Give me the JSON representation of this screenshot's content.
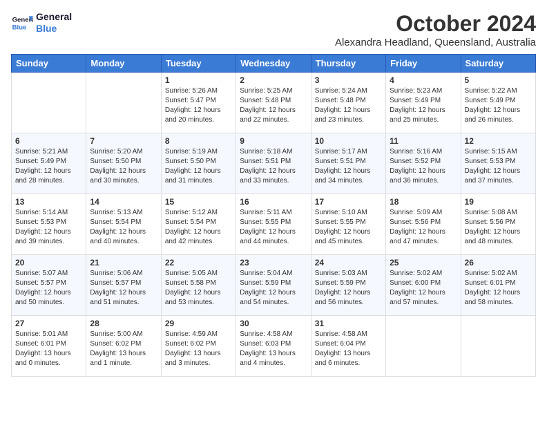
{
  "header": {
    "logo_line1": "General",
    "logo_line2": "Blue",
    "month": "October 2024",
    "location": "Alexandra Headland, Queensland, Australia"
  },
  "weekdays": [
    "Sunday",
    "Monday",
    "Tuesday",
    "Wednesday",
    "Thursday",
    "Friday",
    "Saturday"
  ],
  "weeks": [
    [
      {
        "day": "",
        "info": ""
      },
      {
        "day": "",
        "info": ""
      },
      {
        "day": "1",
        "info": "Sunrise: 5:26 AM\nSunset: 5:47 PM\nDaylight: 12 hours\nand 20 minutes."
      },
      {
        "day": "2",
        "info": "Sunrise: 5:25 AM\nSunset: 5:48 PM\nDaylight: 12 hours\nand 22 minutes."
      },
      {
        "day": "3",
        "info": "Sunrise: 5:24 AM\nSunset: 5:48 PM\nDaylight: 12 hours\nand 23 minutes."
      },
      {
        "day": "4",
        "info": "Sunrise: 5:23 AM\nSunset: 5:49 PM\nDaylight: 12 hours\nand 25 minutes."
      },
      {
        "day": "5",
        "info": "Sunrise: 5:22 AM\nSunset: 5:49 PM\nDaylight: 12 hours\nand 26 minutes."
      }
    ],
    [
      {
        "day": "6",
        "info": "Sunrise: 5:21 AM\nSunset: 5:49 PM\nDaylight: 12 hours\nand 28 minutes."
      },
      {
        "day": "7",
        "info": "Sunrise: 5:20 AM\nSunset: 5:50 PM\nDaylight: 12 hours\nand 30 minutes."
      },
      {
        "day": "8",
        "info": "Sunrise: 5:19 AM\nSunset: 5:50 PM\nDaylight: 12 hours\nand 31 minutes."
      },
      {
        "day": "9",
        "info": "Sunrise: 5:18 AM\nSunset: 5:51 PM\nDaylight: 12 hours\nand 33 minutes."
      },
      {
        "day": "10",
        "info": "Sunrise: 5:17 AM\nSunset: 5:51 PM\nDaylight: 12 hours\nand 34 minutes."
      },
      {
        "day": "11",
        "info": "Sunrise: 5:16 AM\nSunset: 5:52 PM\nDaylight: 12 hours\nand 36 minutes."
      },
      {
        "day": "12",
        "info": "Sunrise: 5:15 AM\nSunset: 5:53 PM\nDaylight: 12 hours\nand 37 minutes."
      }
    ],
    [
      {
        "day": "13",
        "info": "Sunrise: 5:14 AM\nSunset: 5:53 PM\nDaylight: 12 hours\nand 39 minutes."
      },
      {
        "day": "14",
        "info": "Sunrise: 5:13 AM\nSunset: 5:54 PM\nDaylight: 12 hours\nand 40 minutes."
      },
      {
        "day": "15",
        "info": "Sunrise: 5:12 AM\nSunset: 5:54 PM\nDaylight: 12 hours\nand 42 minutes."
      },
      {
        "day": "16",
        "info": "Sunrise: 5:11 AM\nSunset: 5:55 PM\nDaylight: 12 hours\nand 44 minutes."
      },
      {
        "day": "17",
        "info": "Sunrise: 5:10 AM\nSunset: 5:55 PM\nDaylight: 12 hours\nand 45 minutes."
      },
      {
        "day": "18",
        "info": "Sunrise: 5:09 AM\nSunset: 5:56 PM\nDaylight: 12 hours\nand 47 minutes."
      },
      {
        "day": "19",
        "info": "Sunrise: 5:08 AM\nSunset: 5:56 PM\nDaylight: 12 hours\nand 48 minutes."
      }
    ],
    [
      {
        "day": "20",
        "info": "Sunrise: 5:07 AM\nSunset: 5:57 PM\nDaylight: 12 hours\nand 50 minutes."
      },
      {
        "day": "21",
        "info": "Sunrise: 5:06 AM\nSunset: 5:57 PM\nDaylight: 12 hours\nand 51 minutes."
      },
      {
        "day": "22",
        "info": "Sunrise: 5:05 AM\nSunset: 5:58 PM\nDaylight: 12 hours\nand 53 minutes."
      },
      {
        "day": "23",
        "info": "Sunrise: 5:04 AM\nSunset: 5:59 PM\nDaylight: 12 hours\nand 54 minutes."
      },
      {
        "day": "24",
        "info": "Sunrise: 5:03 AM\nSunset: 5:59 PM\nDaylight: 12 hours\nand 56 minutes."
      },
      {
        "day": "25",
        "info": "Sunrise: 5:02 AM\nSunset: 6:00 PM\nDaylight: 12 hours\nand 57 minutes."
      },
      {
        "day": "26",
        "info": "Sunrise: 5:02 AM\nSunset: 6:01 PM\nDaylight: 12 hours\nand 58 minutes."
      }
    ],
    [
      {
        "day": "27",
        "info": "Sunrise: 5:01 AM\nSunset: 6:01 PM\nDaylight: 13 hours\nand 0 minutes."
      },
      {
        "day": "28",
        "info": "Sunrise: 5:00 AM\nSunset: 6:02 PM\nDaylight: 13 hours\nand 1 minute."
      },
      {
        "day": "29",
        "info": "Sunrise: 4:59 AM\nSunset: 6:02 PM\nDaylight: 13 hours\nand 3 minutes."
      },
      {
        "day": "30",
        "info": "Sunrise: 4:58 AM\nSunset: 6:03 PM\nDaylight: 13 hours\nand 4 minutes."
      },
      {
        "day": "31",
        "info": "Sunrise: 4:58 AM\nSunset: 6:04 PM\nDaylight: 13 hours\nand 6 minutes."
      },
      {
        "day": "",
        "info": ""
      },
      {
        "day": "",
        "info": ""
      }
    ]
  ]
}
